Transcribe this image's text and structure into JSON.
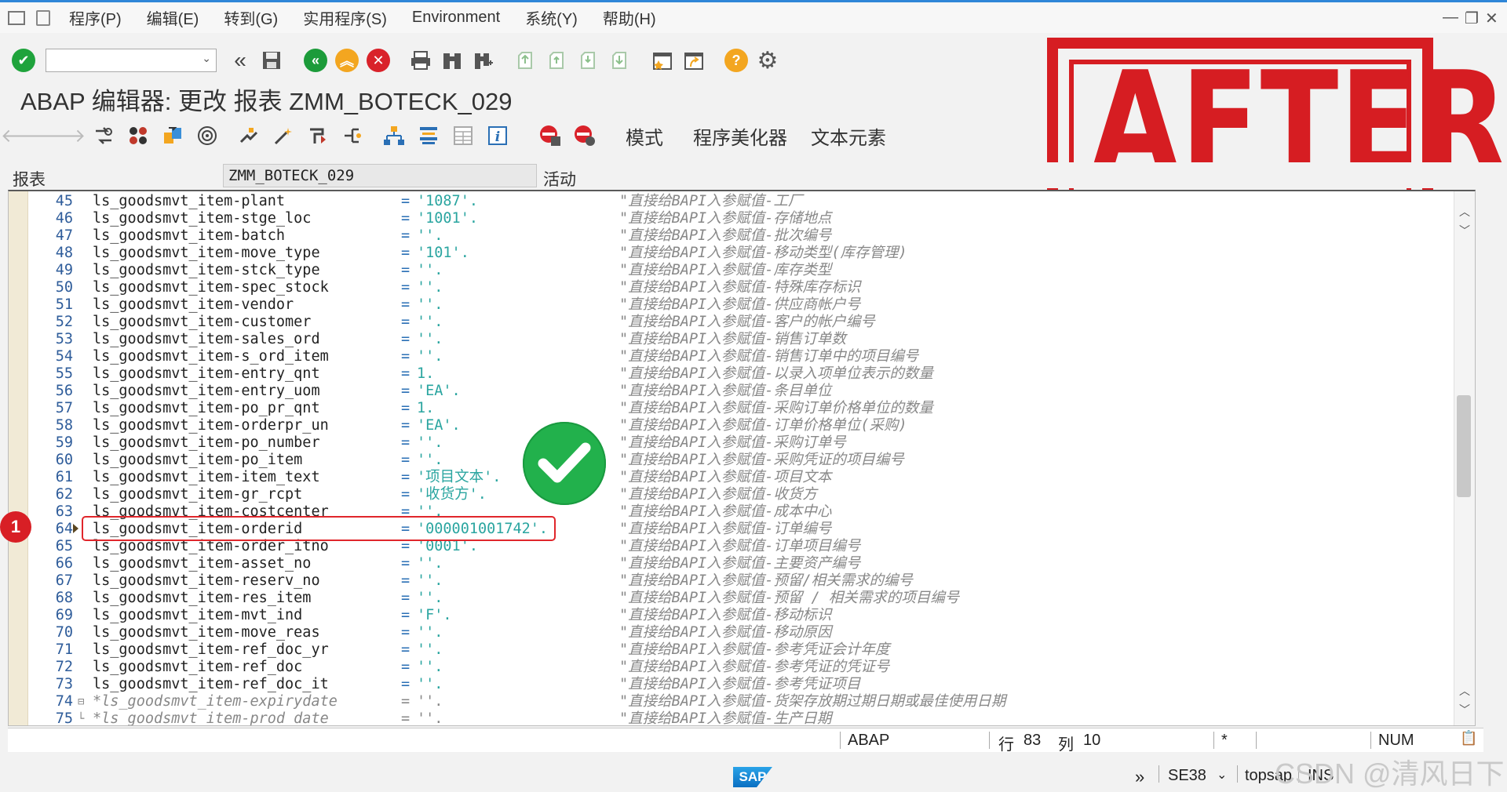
{
  "menu": {
    "items": [
      "程序(P)",
      "编辑(E)",
      "转到(G)",
      "实用程序(S)",
      "Environment",
      "系统(Y)",
      "帮助(H)"
    ]
  },
  "toolbar": {
    "command_field_value": "",
    "icons": [
      "enter-check-icon",
      "command-field",
      "back-double-chevron-icon",
      "save-icon",
      "back-icon",
      "exit-icon",
      "cancel-icon",
      "print-icon",
      "find-icon",
      "find-next-icon",
      "first-page-icon",
      "previous-page-icon",
      "next-page-icon",
      "last-page-icon",
      "create-session-icon",
      "shortcut-icon",
      "help-icon",
      "settings-icon"
    ]
  },
  "title": "ABAP 编辑器: 更改 报表 ZMM_BOTECK_029",
  "app_toolbar": {
    "buttons": [
      "模式",
      "程序美化器",
      "文本元素"
    ]
  },
  "header": {
    "label": "报表",
    "program_name": "ZMM_BOTECK_029",
    "status": "活动"
  },
  "code_lines": [
    {
      "n": "45",
      "code": "ls_goodsmvt_item-plant",
      "val": "'1087'.",
      "cmt": "\"直接给BAPI入参赋值-工厂"
    },
    {
      "n": "46",
      "code": "ls_goodsmvt_item-stge_loc",
      "val": "'1001'.",
      "cmt": "\"直接给BAPI入参赋值-存储地点"
    },
    {
      "n": "47",
      "code": "ls_goodsmvt_item-batch",
      "val": "''.",
      "cmt": "\"直接给BAPI入参赋值-批次编号"
    },
    {
      "n": "48",
      "code": "ls_goodsmvt_item-move_type",
      "val": "'101'.",
      "cmt": "\"直接给BAPI入参赋值-移动类型(库存管理)"
    },
    {
      "n": "49",
      "code": "ls_goodsmvt_item-stck_type",
      "val": "''.",
      "cmt": "\"直接给BAPI入参赋值-库存类型"
    },
    {
      "n": "50",
      "code": "ls_goodsmvt_item-spec_stock",
      "val": "''.",
      "cmt": "\"直接给BAPI入参赋值-特殊库存标识"
    },
    {
      "n": "51",
      "code": "ls_goodsmvt_item-vendor",
      "val": "''.",
      "cmt": "\"直接给BAPI入参赋值-供应商帐户号"
    },
    {
      "n": "52",
      "code": "ls_goodsmvt_item-customer",
      "val": "''.",
      "cmt": "\"直接给BAPI入参赋值-客户的帐户编号"
    },
    {
      "n": "53",
      "code": "ls_goodsmvt_item-sales_ord",
      "val": "''.",
      "cmt": "\"直接给BAPI入参赋值-销售订单数"
    },
    {
      "n": "54",
      "code": "ls_goodsmvt_item-s_ord_item",
      "val": "''.",
      "cmt": "\"直接给BAPI入参赋值-销售订单中的项目编号"
    },
    {
      "n": "55",
      "code": "ls_goodsmvt_item-entry_qnt",
      "val": "1.",
      "cmt": "\"直接给BAPI入参赋值-以录入项单位表示的数量"
    },
    {
      "n": "56",
      "code": "ls_goodsmvt_item-entry_uom",
      "val": "'EA'.",
      "cmt": "\"直接给BAPI入参赋值-条目单位"
    },
    {
      "n": "57",
      "code": "ls_goodsmvt_item-po_pr_qnt",
      "val": "1.",
      "cmt": "\"直接给BAPI入参赋值-采购订单价格单位的数量"
    },
    {
      "n": "58",
      "code": "ls_goodsmvt_item-orderpr_un",
      "val": "'EA'.",
      "cmt": "\"直接给BAPI入参赋值-订单价格单位(采购)"
    },
    {
      "n": "59",
      "code": "ls_goodsmvt_item-po_number",
      "val": "''.",
      "cmt": "\"直接给BAPI入参赋值-采购订单号"
    },
    {
      "n": "60",
      "code": "ls_goodsmvt_item-po_item",
      "val": "''.",
      "cmt": "\"直接给BAPI入参赋值-采购凭证的项目编号"
    },
    {
      "n": "61",
      "code": "ls_goodsmvt_item-item_text",
      "val": "'项目文本'.",
      "cmt": "\"直接给BAPI入参赋值-项目文本"
    },
    {
      "n": "62",
      "code": "ls_goodsmvt_item-gr_rcpt",
      "val": "'收货方'.",
      "cmt": "\"直接给BAPI入参赋值-收货方"
    },
    {
      "n": "63",
      "code": "ls_goodsmvt_item-costcenter",
      "val": "''.",
      "cmt": "\"直接给BAPI入参赋值-成本中心"
    },
    {
      "n": "64",
      "code": "ls_goodsmvt_item-orderid",
      "val": "'000001001742'.",
      "cmt": "\"直接给BAPI入参赋值-订单编号"
    },
    {
      "n": "65",
      "code": "ls_goodsmvt_item-order_itno",
      "val": "'0001'.",
      "cmt": "\"直接给BAPI入参赋值-订单项目编号"
    },
    {
      "n": "66",
      "code": "ls_goodsmvt_item-asset_no",
      "val": "''.",
      "cmt": "\"直接给BAPI入参赋值-主要资产编号"
    },
    {
      "n": "67",
      "code": "ls_goodsmvt_item-reserv_no",
      "val": "''.",
      "cmt": "\"直接给BAPI入参赋值-预留/相关需求的编号"
    },
    {
      "n": "68",
      "code": "ls_goodsmvt_item-res_item",
      "val": "''.",
      "cmt": "\"直接给BAPI入参赋值-预留 / 相关需求的项目编号"
    },
    {
      "n": "69",
      "code": "ls_goodsmvt_item-mvt_ind",
      "val": "'F'.",
      "cmt": "\"直接给BAPI入参赋值-移动标识"
    },
    {
      "n": "70",
      "code": "ls_goodsmvt_item-move_reas",
      "val": "''.",
      "cmt": "\"直接给BAPI入参赋值-移动原因"
    },
    {
      "n": "71",
      "code": "ls_goodsmvt_item-ref_doc_yr",
      "val": "''.",
      "cmt": "\"直接给BAPI入参赋值-参考凭证会计年度"
    },
    {
      "n": "72",
      "code": "ls_goodsmvt_item-ref_doc",
      "val": "''.",
      "cmt": "\"直接给BAPI入参赋值-参考凭证的凭证号"
    },
    {
      "n": "73",
      "code": "ls_goodsmvt_item-ref_doc_it",
      "val": "''.",
      "cmt": "\"直接给BAPI入参赋值-参考凭证项目"
    },
    {
      "n": "74",
      "code": "*ls_goodsmvt_item-expirydate",
      "val": "''.",
      "cmt": "\"直接给BAPI入参赋值-货架存放期过期日期或最佳使用日期"
    },
    {
      "n": "75",
      "code": "*ls_goodsmvt_item-prod_date",
      "val": "''.",
      "cmt": "\"直接给BAPI入参赋值-生产日期"
    }
  ],
  "annotation": {
    "badge_number": "1",
    "stamp_text": "AFTER"
  },
  "status": {
    "language": "ABAP",
    "row_label": "行",
    "row_value": "83",
    "col_label": "列",
    "col_value": "10",
    "modified_marker": "*",
    "num_lock": "NUM"
  },
  "bottom": {
    "sap_logo": "SAP",
    "transaction": "SE38",
    "server": "topsap",
    "mode": "INS",
    "watermark": "CSDN @清风日下"
  },
  "colors": {
    "accent": "#2f86d8",
    "stamp_red": "#d61d22",
    "check_green": "#22b14c",
    "value_teal": "#2aa5a0",
    "comment_gray": "#888888"
  }
}
